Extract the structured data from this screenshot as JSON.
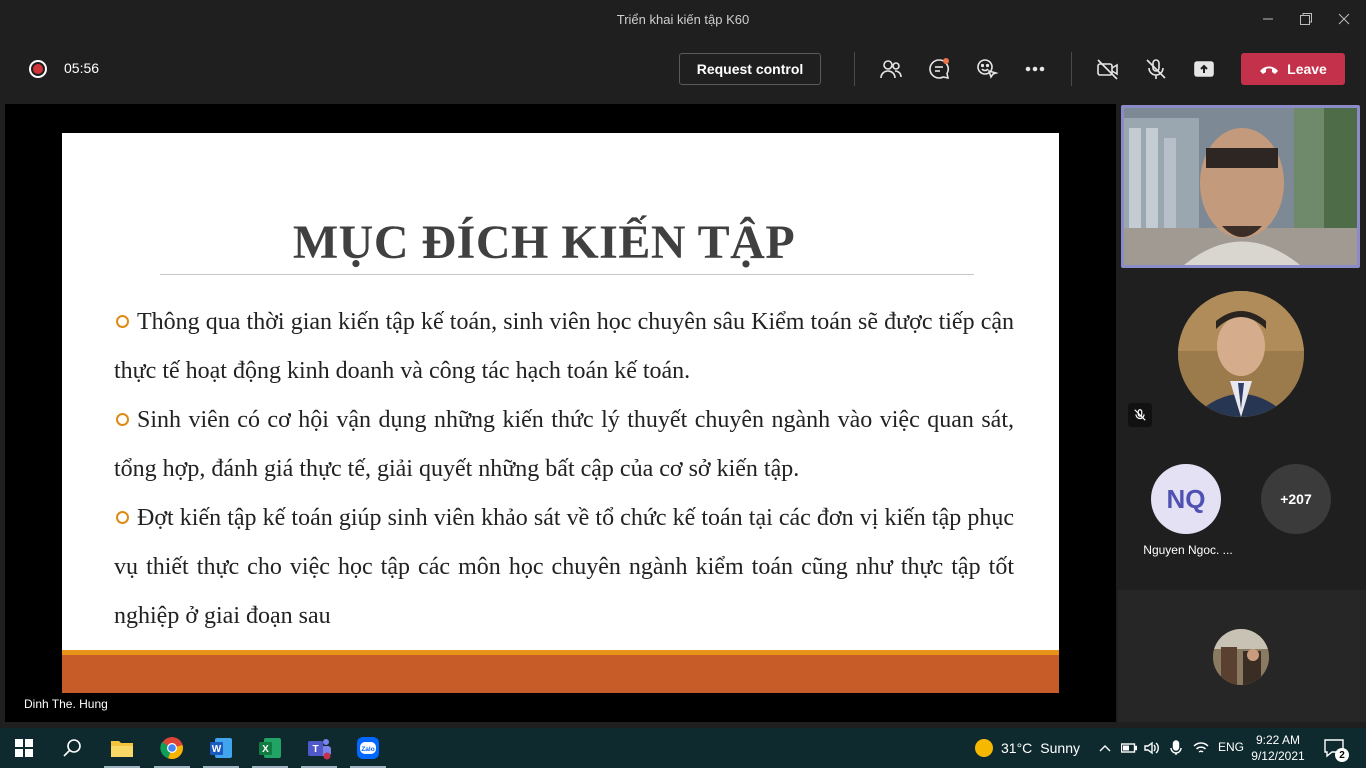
{
  "window": {
    "title": "Triển khai kiến tập K60",
    "minimize_icon": "minimize-icon",
    "restore_icon": "restore-icon",
    "close_icon": "close-icon"
  },
  "toolbar": {
    "recording_icon": "record-icon",
    "timer": "05:56",
    "request_control_label": "Request control",
    "participants_icon": "people-icon",
    "chat_icon": "chat-icon",
    "reactions_icon": "reactions-icon",
    "more_icon": "more-options-icon",
    "camera_icon": "camera-off-icon",
    "mic_icon": "mic-off-icon",
    "share_icon": "share-tray-icon",
    "leave_label": "Leave",
    "leave_color": "#c4314b",
    "chat_badge_color": "#e97548"
  },
  "slide": {
    "title": "MỤC ĐÍCH KIẾN TẬP",
    "bullets": [
      "Thông qua thời gian kiến tập kế toán, sinh viên học chuyên sâu Kiểm toán sẽ được tiếp cận thực tế hoạt động kinh doanh và công tác hạch toán kế toán.",
      "Sinh viên có cơ hội vận dụng những kiến thức lý thuyết chuyên ngành vào việc quan sát, tổng hợp, đánh giá thực tế, giải quyết những bất cập của cơ sở kiến tập.",
      "Đợt kiến tập kế toán giúp sinh viên khảo sát về tổ chức kế toán tại các đơn vị kiến tập phục vụ thiết thực cho việc học tập các môn học chuyên ngành kiểm toán cũng như thực tập tốt nghiệp ở giai đoạn sau"
    ],
    "bullet_color": "#e08a16",
    "band_color": "#c75c28"
  },
  "presenter": {
    "name": "Dinh The. Hung"
  },
  "participants": {
    "muted_icon": "mic-off-icon",
    "initials": "NQ",
    "initials_name": "Nguyen Ngoc. ...",
    "overflow_count": "+207"
  },
  "taskbar": {
    "apps": [
      {
        "name": "windows-start-icon"
      },
      {
        "name": "search-icon"
      },
      {
        "name": "file-explorer-icon"
      },
      {
        "name": "chrome-icon"
      },
      {
        "name": "word-icon"
      },
      {
        "name": "excel-icon"
      },
      {
        "name": "teams-icon"
      },
      {
        "name": "zalo-icon"
      }
    ],
    "zalo_label": "Zalo",
    "weather_temp": "31°C",
    "weather_desc": "Sunny",
    "language": "ENG",
    "time": "9:22 AM",
    "date": "9/12/2021",
    "notification_count": "2"
  }
}
